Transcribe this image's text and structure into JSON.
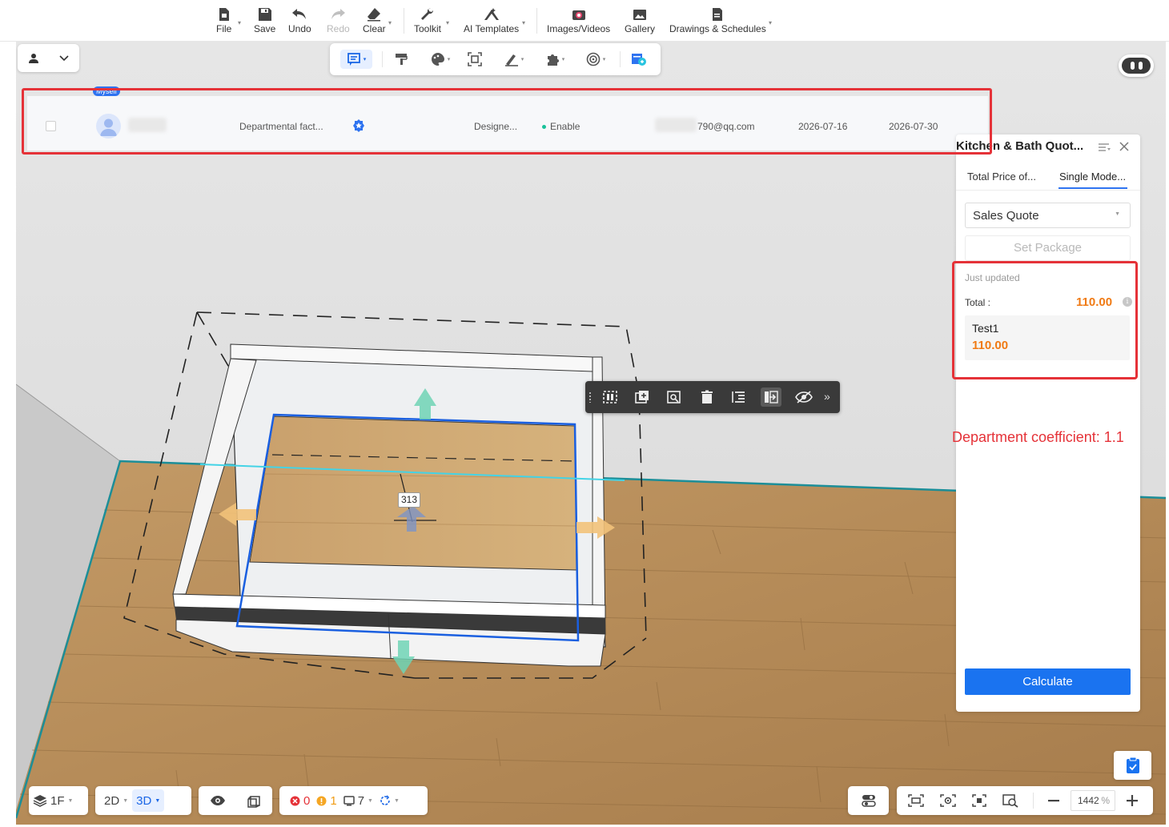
{
  "toolbar": {
    "items": [
      {
        "label": "File",
        "icon": "file-icon"
      },
      {
        "label": "Save",
        "icon": "save-icon"
      },
      {
        "label": "Undo",
        "icon": "undo-icon"
      },
      {
        "label": "Redo",
        "icon": "redo-icon",
        "disabled": true
      },
      {
        "label": "Clear",
        "icon": "eraser-icon"
      },
      {
        "label": "Toolkit",
        "icon": "wrench-icon"
      },
      {
        "label": "AI Templates",
        "icon": "ai-templates-icon"
      },
      {
        "label": "Images/Videos",
        "icon": "camera-icon"
      },
      {
        "label": "Gallery",
        "icon": "gallery-icon"
      },
      {
        "label": "Drawings & Schedules",
        "icon": "drawings-icon"
      }
    ]
  },
  "record": {
    "tag": "Myself",
    "role": "Departmental fact...",
    "designer": "Designe...",
    "status": "Enable",
    "email": "790@qq.com",
    "start_date": "2026-07-16",
    "end_date": "2026-07-30"
  },
  "panel": {
    "title": "Kitchen & Bath Quot...",
    "tabs": [
      {
        "label": "Total Price of..."
      },
      {
        "label": "Single Mode...",
        "active": true
      }
    ],
    "quote_type": "Sales Quote",
    "package_button": "Set Package",
    "summary": {
      "updated": "Just updated",
      "total_label": "Total :",
      "total_value": "110.00",
      "items": [
        {
          "name": "Test1",
          "value": "110.00"
        }
      ]
    },
    "calculate_button": "Calculate"
  },
  "annotation": "Department coefficient: 1.1",
  "scene": {
    "dimension_label": "313"
  },
  "bottom_bar": {
    "floor": "1F",
    "view_2d": "2D",
    "view_3d": "3D",
    "errors": "0",
    "warnings": "1",
    "items": "7",
    "zoom_value": "1442",
    "zoom_unit": "%"
  },
  "colors": {
    "accent": "#1a73f0",
    "price": "#f07a14",
    "highlight": "#e53238",
    "status_enabled": "#19c29a"
  }
}
